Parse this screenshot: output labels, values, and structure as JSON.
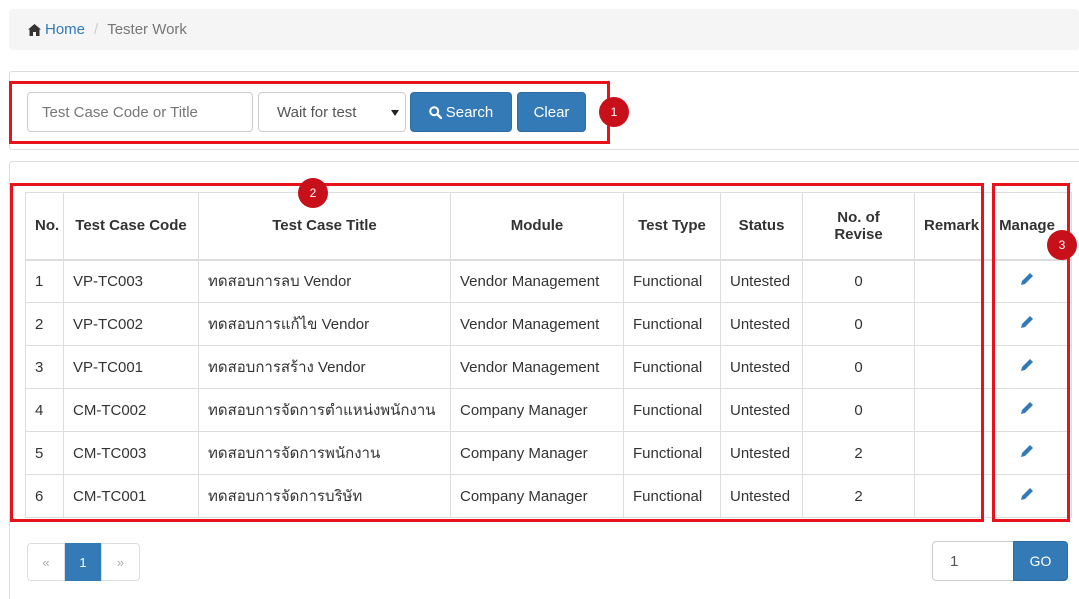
{
  "breadcrumb": {
    "home": "Home",
    "separator": "/",
    "current": "Tester Work"
  },
  "search": {
    "placeholder": "Test Case Code or Title",
    "value": "",
    "status_selected": "Wait for test",
    "search_label": "Search",
    "clear_label": "Clear"
  },
  "annotations": [
    "1",
    "2",
    "3"
  ],
  "table": {
    "headers": [
      "No.",
      "Test Case Code",
      "Test Case Title",
      "Module",
      "Test Type",
      "Status",
      "No. of Revise",
      "Remark",
      "Manage"
    ],
    "rows": [
      {
        "no": "1",
        "code": "VP-TC003",
        "title": "ทดสอบการลบ Vendor",
        "module": "Vendor Management",
        "type": "Functional",
        "status": "Untested",
        "revise": "0",
        "remark": ""
      },
      {
        "no": "2",
        "code": "VP-TC002",
        "title": "ทดสอบการแก้ไข Vendor",
        "module": "Vendor Management",
        "type": "Functional",
        "status": "Untested",
        "revise": "0",
        "remark": ""
      },
      {
        "no": "3",
        "code": "VP-TC001",
        "title": "ทดสอบการสร้าง Vendor",
        "module": "Vendor Management",
        "type": "Functional",
        "status": "Untested",
        "revise": "0",
        "remark": ""
      },
      {
        "no": "4",
        "code": "CM-TC002",
        "title": "ทดสอบการจัดการตำแหน่งพนักงาน",
        "module": "Company Manager",
        "type": "Functional",
        "status": "Untested",
        "revise": "0",
        "remark": ""
      },
      {
        "no": "5",
        "code": "CM-TC003",
        "title": "ทดสอบการจัดการพนักงาน",
        "module": "Company Manager",
        "type": "Functional",
        "status": "Untested",
        "revise": "2",
        "remark": ""
      },
      {
        "no": "6",
        "code": "CM-TC001",
        "title": "ทดสอบการจัดการบริษัท",
        "module": "Company Manager",
        "type": "Functional",
        "status": "Untested",
        "revise": "2",
        "remark": ""
      }
    ]
  },
  "pagination": {
    "prev": "«",
    "current": "1",
    "next": "»"
  },
  "goto": {
    "value": "1",
    "button": "GO"
  },
  "colors": {
    "primary": "#337ab7",
    "highlight": "#e8131a",
    "marker": "#c8101b"
  }
}
